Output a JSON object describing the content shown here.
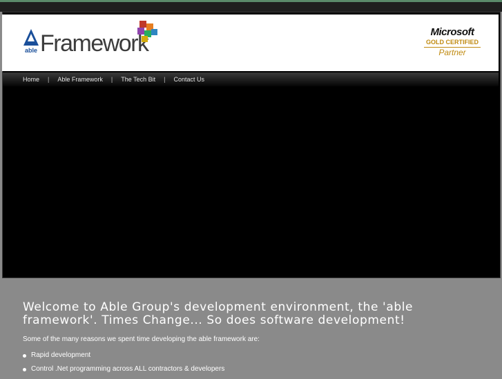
{
  "header": {
    "logo": {
      "brand_small": "able",
      "brand_word": "Framework"
    },
    "ms_badge": {
      "brand": "Microsoft",
      "tier": "GOLD CERTIFIED",
      "label": "Partner"
    }
  },
  "nav": {
    "items": [
      {
        "label": "Home"
      },
      {
        "label": "Able Framework"
      },
      {
        "label": "The Tech Bit"
      },
      {
        "label": "Contact Us"
      }
    ],
    "separator": "|"
  },
  "content": {
    "headline_line1": "Welcome to Able Group's development environment, the 'able",
    "headline_line2": "framework'. Times Change... So does software development!",
    "intro": "Some of the many reasons we spent time developing the able framework are:",
    "reasons": [
      "Rapid development",
      "Control .Net programming across ALL contractors & developers"
    ]
  },
  "colors": {
    "background": "#8a8a8a",
    "accent_strip": "#5a8a6a",
    "gold": "#c08a10",
    "logo_blue": "#1a4f9a"
  }
}
